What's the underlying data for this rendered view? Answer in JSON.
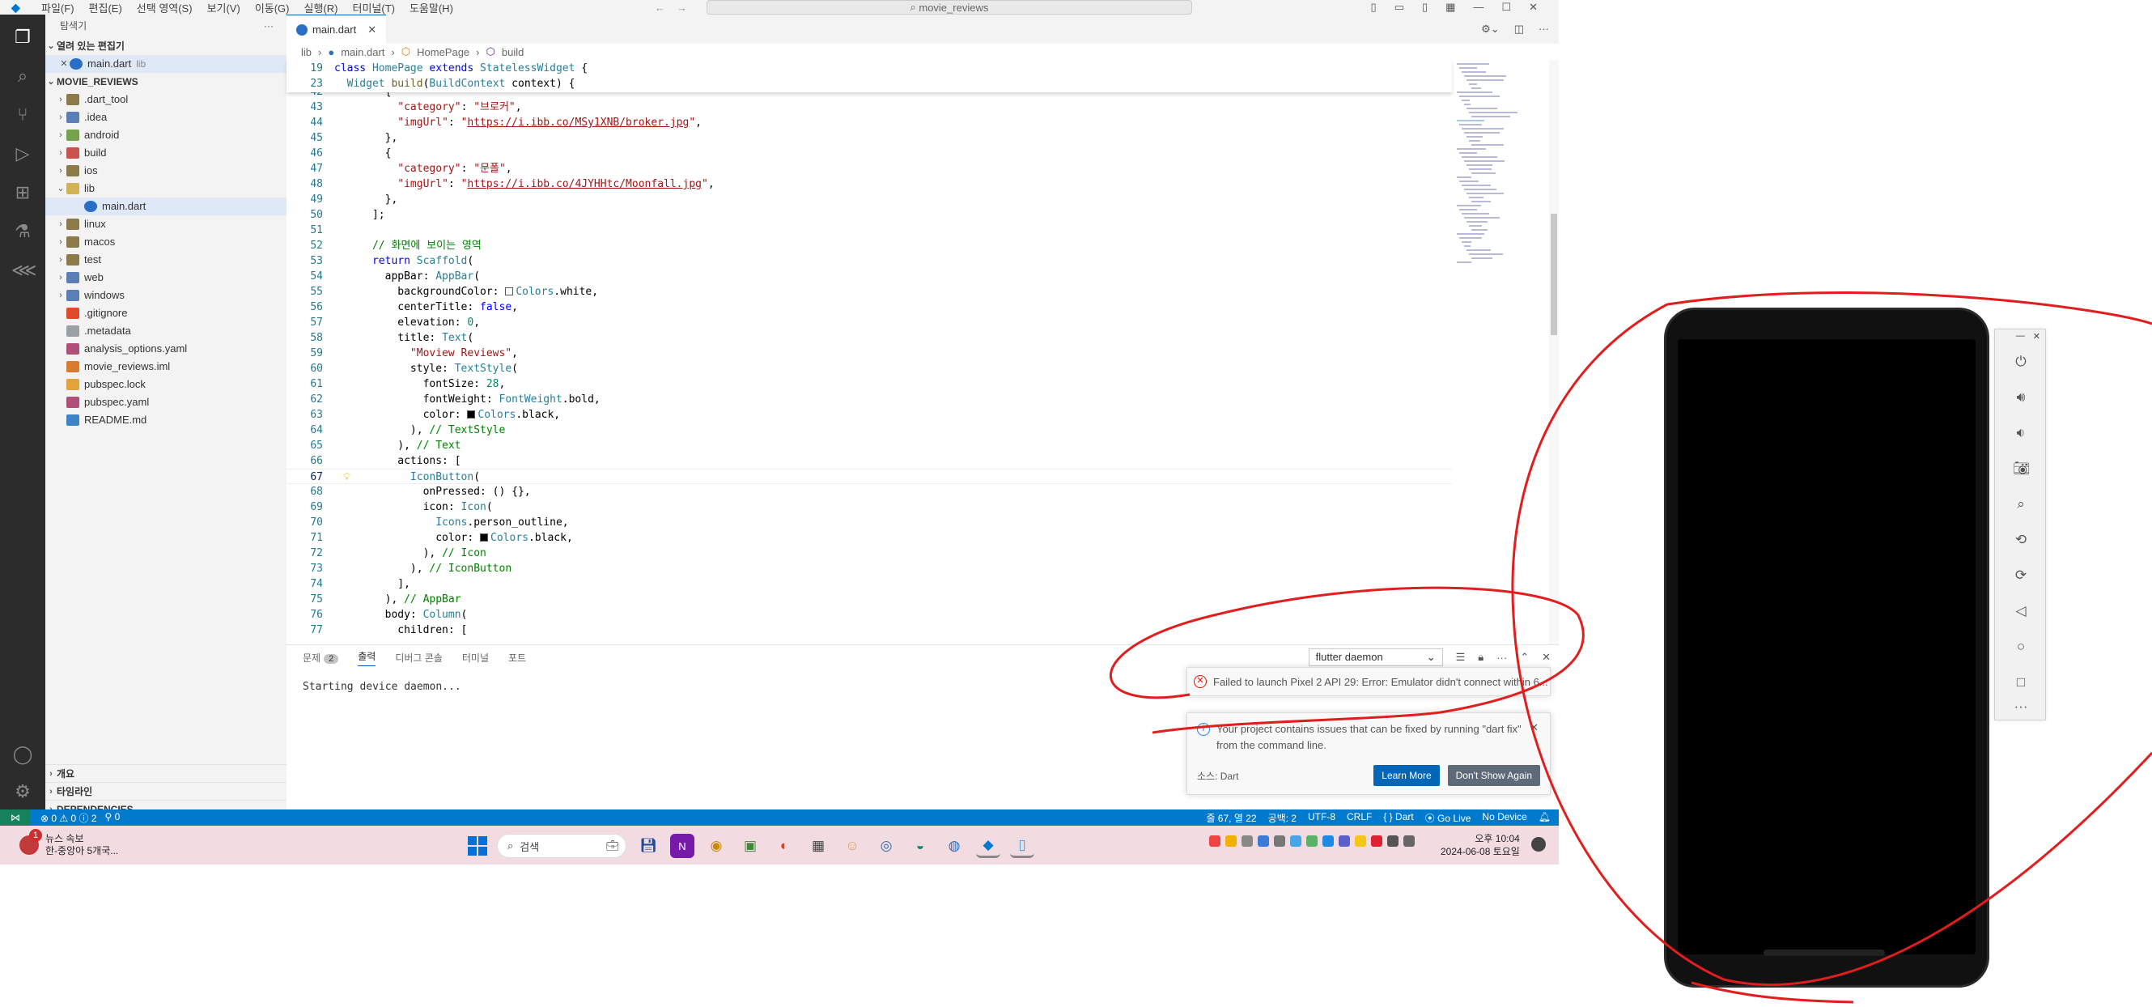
{
  "titlebar": {
    "menus": [
      "파일(F)",
      "편집(E)",
      "선택 영역(S)",
      "보기(V)",
      "이동(G)",
      "실행(R)",
      "터미널(T)",
      "도움말(H)"
    ],
    "search": "movie_reviews"
  },
  "sidebar": {
    "title": "탐색기",
    "open_editors_label": "열려 있는 편집기",
    "open_file": "main.dart",
    "open_file_desc": "lib",
    "project": "MOVIE_REVIEWS",
    "items": [
      {
        "label": ".dart_tool",
        "icon": "folder-icon"
      },
      {
        "label": ".idea",
        "icon": "folder-icon"
      },
      {
        "label": "android",
        "icon": "folder-icon"
      },
      {
        "label": "build",
        "icon": "folder-icon"
      },
      {
        "label": "ios",
        "icon": "folder-icon"
      },
      {
        "label": "lib",
        "icon": "folder-open-icon"
      },
      {
        "label": "main.dart",
        "icon": "dart-file-icon"
      },
      {
        "label": "linux",
        "icon": "folder-icon"
      },
      {
        "label": "macos",
        "icon": "folder-icon"
      },
      {
        "label": "test",
        "icon": "folder-icon"
      },
      {
        "label": "web",
        "icon": "folder-icon"
      },
      {
        "label": "windows",
        "icon": "folder-icon"
      },
      {
        "label": ".gitignore",
        "icon": "git-icon"
      },
      {
        "label": ".metadata",
        "icon": "file-icon"
      },
      {
        "label": "analysis_options.yaml",
        "icon": "yaml-icon"
      },
      {
        "label": "movie_reviews.iml",
        "icon": "xml-icon"
      },
      {
        "label": "pubspec.lock",
        "icon": "lock-icon"
      },
      {
        "label": "pubspec.yaml",
        "icon": "yaml-icon"
      },
      {
        "label": "README.md",
        "icon": "info-icon"
      }
    ],
    "bottom_sections": [
      "개요",
      "타임라인",
      "DEPENDENCIES"
    ]
  },
  "editor": {
    "tab": "main.dart",
    "breadcrumb": [
      "lib",
      "main.dart",
      "HomePage",
      "build"
    ],
    "sticky": [
      {
        "n": "19",
        "code": "class HomePage extends StatelessWidget {"
      },
      {
        "n": "23",
        "code": "  Widget build(BuildContext context) {"
      }
    ],
    "lines": [
      {
        "n": "42",
        "code": "        {"
      },
      {
        "n": "43",
        "code": "          \"category\": \"브로커\","
      },
      {
        "n": "44",
        "code": "          \"imgUrl\": \"https://i.ibb.co/MSy1XNB/broker.jpg\","
      },
      {
        "n": "45",
        "code": "        },"
      },
      {
        "n": "46",
        "code": "        {"
      },
      {
        "n": "47",
        "code": "          \"category\": \"문폴\","
      },
      {
        "n": "48",
        "code": "          \"imgUrl\": \"https://i.ibb.co/4JYHHtc/Moonfall.jpg\","
      },
      {
        "n": "49",
        "code": "        },"
      },
      {
        "n": "50",
        "code": "      ];"
      },
      {
        "n": "51",
        "code": ""
      },
      {
        "n": "52",
        "code": "      // 화면에 보이는 영역"
      },
      {
        "n": "53",
        "code": "      return Scaffold("
      },
      {
        "n": "54",
        "code": "        appBar: AppBar("
      },
      {
        "n": "55",
        "code": "          backgroundColor: Colors.white,"
      },
      {
        "n": "56",
        "code": "          centerTitle: false,"
      },
      {
        "n": "57",
        "code": "          elevation: 0,"
      },
      {
        "n": "58",
        "code": "          title: Text("
      },
      {
        "n": "59",
        "code": "            \"Moview Reviews\","
      },
      {
        "n": "60",
        "code": "            style: TextStyle("
      },
      {
        "n": "61",
        "code": "              fontSize: 28,"
      },
      {
        "n": "62",
        "code": "              fontWeight: FontWeight.bold,"
      },
      {
        "n": "63",
        "code": "              color: Colors.black,"
      },
      {
        "n": "64",
        "code": "            ), // TextStyle"
      },
      {
        "n": "65",
        "code": "          ), // Text"
      },
      {
        "n": "66",
        "code": "          actions: ["
      },
      {
        "n": "67",
        "code": "            IconButton("
      },
      {
        "n": "68",
        "code": "              onPressed: () {},"
      },
      {
        "n": "69",
        "code": "              icon: Icon("
      },
      {
        "n": "70",
        "code": "                Icons.person_outline,"
      },
      {
        "n": "71",
        "code": "                color: Colors.black,"
      },
      {
        "n": "72",
        "code": "              ), // Icon"
      },
      {
        "n": "73",
        "code": "            ), // IconButton"
      },
      {
        "n": "74",
        "code": "          ],"
      },
      {
        "n": "75",
        "code": "        ), // AppBar"
      },
      {
        "n": "76",
        "code": "        body: Column("
      },
      {
        "n": "77",
        "code": "          children: ["
      }
    ]
  },
  "panel": {
    "tabs": [
      "문제",
      "출력",
      "디버그 콘솔",
      "터미널",
      "포트"
    ],
    "problems_count": "2",
    "channel": "flutter daemon",
    "output": "Starting device daemon..."
  },
  "notifications": {
    "error": "Failed to launch Pixel 2 API 29: Error: Emulator didn't connect within 6...",
    "info": "Your project contains issues that can be fixed by running \"dart fix\" from the command line.",
    "source": "소스: Dart",
    "learn_more": "Learn More",
    "dont_show": "Don't Show Again"
  },
  "statusbar": {
    "problems": "⊗ 0 ⚠ 0 ⓘ 2",
    "ports": "⚲ 0",
    "position": "줄 67, 열 22",
    "spaces": "공백: 2",
    "encoding": "UTF-8",
    "eol": "CRLF",
    "language": "{ } Dart",
    "golive": "Go Live",
    "device": "No Device"
  },
  "taskbar": {
    "news_badge": "1",
    "news_title": "뉴스 속보",
    "news_text": "한-중앙아 5개국...",
    "search": "검색",
    "time_ampm": "오후 10:04",
    "date": "2024-06-08 토요일"
  },
  "colors": {
    "accent": "#007acc",
    "annotation": "#e11d1d"
  }
}
